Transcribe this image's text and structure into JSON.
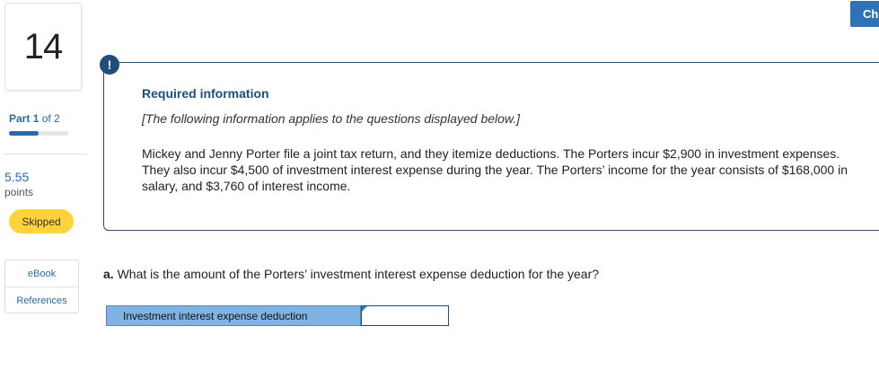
{
  "question": {
    "number": "14"
  },
  "part": {
    "prefix": "Part",
    "current": "1",
    "of_text": "of 2",
    "progress": 0.5
  },
  "points": {
    "value": "5.55",
    "label": "points"
  },
  "status": {
    "label": "Skipped"
  },
  "resources": [
    {
      "label": "eBook"
    },
    {
      "label": "References"
    }
  ],
  "check_button": {
    "label": "Ch"
  },
  "info": {
    "title": "Required information",
    "note": "[The following information applies to the questions displayed below.]",
    "scenario": "Mickey and Jenny Porter file a joint tax return, and they itemize deductions. The Porters incur $2,900 in investment expenses. They also incur $4,500 of investment interest expense during the year. The Porters’ income for the year consists of $168,000 in salary, and $3,760 of interest income."
  },
  "prompt": {
    "letter": "a.",
    "text": "What is the amount of the Porters’ investment interest expense deduction for the year?"
  },
  "answer": {
    "label": "Investment interest expense deduction",
    "value": ""
  },
  "colors": {
    "accent": "#2d6aa3",
    "badge": "#ffd43b",
    "answer_label_bg": "#7fb3e3"
  },
  "icons": {
    "alert": "exclamation-icon",
    "alert_glyph": "!"
  }
}
